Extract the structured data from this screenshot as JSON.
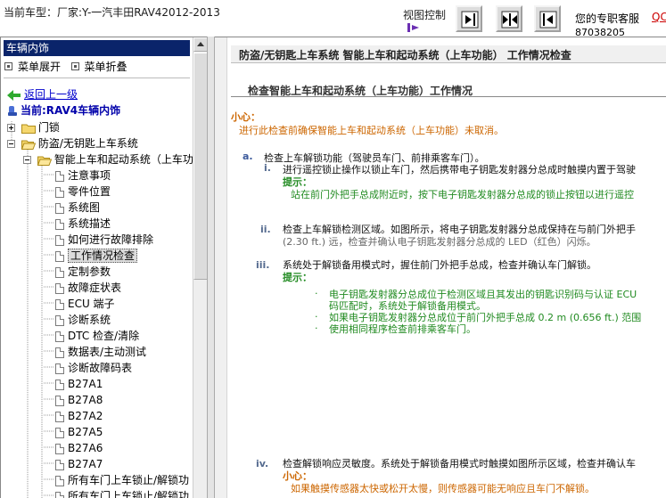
{
  "header": {
    "vehicle_info": "当前车型：厂家:Y-一汽丰田RAV42012-2013",
    "view_control": "视图控制",
    "service_label": "您的专职客服",
    "service_qq": "QC",
    "service_phone": "87038205"
  },
  "left": {
    "panel_title": "车辆内饰",
    "expand_all": "菜单展开",
    "collapse_all": "菜单折叠",
    "back": "返回上一级",
    "current": "当前:RAV4车辆内饰",
    "folders": [
      "门锁",
      "防盗/无钥匙上车系统",
      "智能上车和起动系统（上车功"
    ],
    "items": [
      "注意事项",
      "零件位置",
      "系统图",
      "系统描述",
      "如何进行故障排除",
      "工作情况检查",
      "定制参数",
      "故障症状表",
      "ECU 端子",
      "诊断系统",
      "DTC 检查/清除",
      "数据表/主动测试",
      "诊断故障码表",
      "B27A1",
      "B27A8",
      "B27A2",
      "B27A5",
      "B27A6",
      "B27A7",
      "所有车门上车锁止/解锁功",
      "所有车门上车锁止/解锁功"
    ]
  },
  "doc": {
    "title": "防盗/无钥匙上车系统  智能上车和起动系统（上车功能）  工作情况检查",
    "section": "检查智能上车和起动系统（上车功能）工作情况",
    "caution1_label": "小心：",
    "caution1_text": "进行此检查前确保智能上车和起动系统（上车功能）未取消。",
    "a_num": "a.",
    "a_text": "检查上车解锁功能（驾驶员车门、前排乘客车门）。",
    "i_num": "i.",
    "i_text": "进行遥控锁止操作以锁止车门，然后携带电子钥匙发射器分总成时触摸内置于驾驶",
    "hint1_label": "提示：",
    "hint1_text": "站在前门外把手总成附近时，按下电子钥匙发射器分总成的锁止按钮以进行遥控",
    "ii_num": "ii.",
    "ii_text1": "检查上车解锁检测区域。如图所示，将电子钥匙发射器分总成保持在与前门外把手",
    "ii_text2": "(2.30 ft.) 远，检查并确认电子钥匙发射器分总成的 LED（红色）闪烁。",
    "iii_num": "iii.",
    "iii_text": "系统处于解锁备用模式时，握住前门外把手总成，检查并确认车门解锁。",
    "hint2_label": "提示：",
    "hint2_items": [
      "电子钥匙发射器分总成位于检测区域且其发出的钥匙识别码与认证 ECU",
      "码匹配时，系统处于解锁备用模式。",
      "如果电子钥匙发射器分总成位于前门外把手总成 0.2 m (0.656 ft.) 范围",
      "使用相同程序检查前排乘客车门。"
    ],
    "iv_num": "iv.",
    "iv_text": "检查解锁响应灵敏度。系统处于解锁备用模式时触摸如图所示区域，检查并确认车",
    "caution2_label": "小心：",
    "caution2_text": "如果触摸传感器太快或松开太慢，则传感器可能无响应且车门不解锁。"
  }
}
